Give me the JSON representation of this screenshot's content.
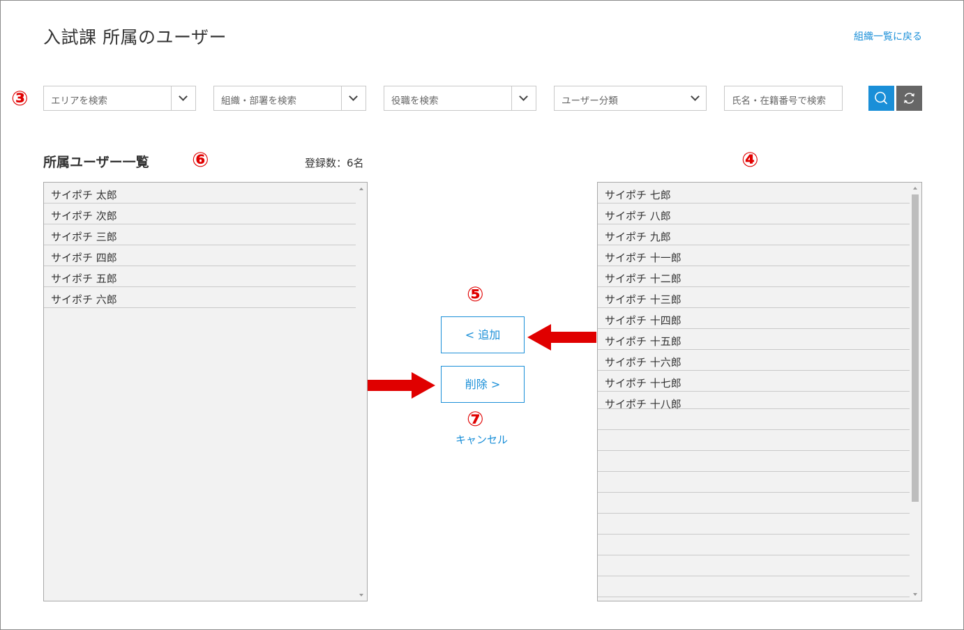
{
  "header": {
    "title": "入試課 所属のユーザー",
    "back_link": "組織一覧に戻る"
  },
  "markers": {
    "filters": "③",
    "candidate_list": "④",
    "add": "⑤",
    "member_list": "⑥",
    "remove": "⑦"
  },
  "filters": {
    "area": "エリアを検索",
    "department": "組織・部署を検索",
    "position": "役職を検索",
    "user_type": "ユーザー分類",
    "name_search": "氏名・在籍番号で検索"
  },
  "icons": {
    "search": "search-icon",
    "reset": "refresh-icon",
    "dropdown": "chevron-down-icon"
  },
  "members": {
    "title": "所属ユーザー一覧",
    "count": "登録数：6名",
    "items": [
      "サイポチ 太郎",
      "サイポチ 次郎",
      "サイポチ 三郎",
      "サイポチ 四郎",
      "サイポチ 五郎",
      "サイポチ 六郎"
    ]
  },
  "candidates": {
    "items": [
      "サイポチ 七郎",
      "サイポチ 八郎",
      "サイポチ 九郎",
      "サイポチ 十一郎",
      "サイポチ 十二郎",
      "サイポチ 十三郎",
      "サイポチ 十四郎",
      "サイポチ 十五郎",
      "サイポチ 十六郎",
      "サイポチ 十七郎",
      "サイポチ 十八郎"
    ]
  },
  "actions": {
    "add": "< 追加",
    "remove": "削除 >",
    "cancel": "キャンセル"
  },
  "colors": {
    "accent": "#1a8fd8",
    "marker": "#e00000",
    "list_bg": "#f2f2f2",
    "reset_button": "#666666"
  }
}
